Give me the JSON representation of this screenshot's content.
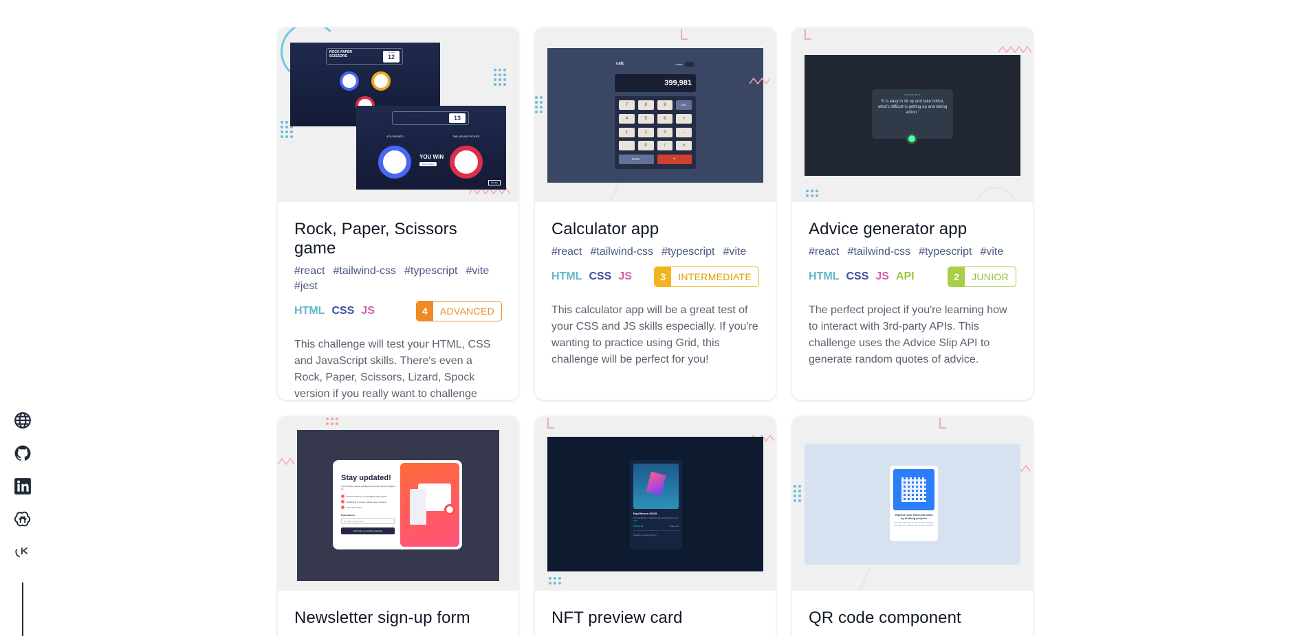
{
  "social": [
    {
      "name": "website-globe-icon",
      "label": "Website"
    },
    {
      "name": "github-icon",
      "label": "GitHub"
    },
    {
      "name": "linkedin-icon",
      "label": "LinkedIn"
    },
    {
      "name": "openai-icon",
      "label": "OpenAI"
    },
    {
      "name": "kodi-logo-icon",
      "label": "Logo"
    }
  ],
  "cards": [
    {
      "title": "Rock, Paper, Scissors game",
      "tags": [
        "#react",
        "#tailwind-css",
        "#typescript",
        "#vite",
        "#jest"
      ],
      "langs": [
        "HTML",
        "CSS",
        "JS"
      ],
      "level_num": "4",
      "level_label": "ADVANCED",
      "level_color": "#f08a24",
      "desc": "This challenge will test your HTML, CSS and JavaScript skills. There's even a Rock, Paper, Scissors, Lizard, Spock version if you really want to challenge yourself.",
      "preview": {
        "game_title": "ROCK PAPER SCISSORS",
        "score_label": "SCORE",
        "score_1": "12",
        "score_2": "13",
        "you_picked": "YOU PICKED",
        "house_picked": "THE HOUSE PICKED",
        "result": "YOU WIN",
        "play_again": "PLAY AGAIN",
        "rules": "RULES"
      }
    },
    {
      "title": "Calculator app",
      "tags": [
        "#react",
        "#tailwind-css",
        "#typescript",
        "#vite"
      ],
      "langs": [
        "HTML",
        "CSS",
        "JS"
      ],
      "level_num": "3",
      "level_label": "INTERMEDIATE",
      "level_color": "#f2b521",
      "desc": "This calculator app will be a great test of your CSS and JS skills especially. If you're wanting to practice using Grid, this challenge will be perfect for you!",
      "preview": {
        "brand": "calc",
        "theme": "THEME",
        "display": "399,981",
        "keys": [
          "7",
          "8",
          "9",
          "DEL",
          "4",
          "5",
          "6",
          "+",
          "1",
          "2",
          "3",
          "-",
          ".",
          "0",
          "/",
          "x"
        ],
        "reset": "RESET",
        "equals": "="
      }
    },
    {
      "title": "Advice generator app",
      "tags": [
        "#react",
        "#tailwind-css",
        "#typescript",
        "#vite"
      ],
      "langs": [
        "HTML",
        "CSS",
        "JS",
        "API"
      ],
      "level_num": "2",
      "level_label": "JUNIOR",
      "level_color": "#a8cf45",
      "desc": "The perfect project if you're learning how to interact with 3rd-party APIs. This challenge uses the Advice Slip API to generate random quotes of advice.",
      "preview": {
        "advice_label": "ADVICE #117",
        "quote": "“It is easy to sit up and take notice, what's difficult is getting up and taking action.”"
      }
    },
    {
      "title": "Newsletter sign-up form",
      "preview": {
        "heading": "Stay updated!",
        "sub": "Join 60,000+ product managers receiving monthly updates on:",
        "items": [
          "Product discovery and building what matters",
          "Measuring to ensure updates are a success",
          "And much more!"
        ],
        "email_label": "Email address",
        "email_placeholder": "email@company.com",
        "cta": "Subscribe to monthly newsletter"
      }
    },
    {
      "title": "NFT preview card",
      "preview": {
        "name": "Equilibrium #3429",
        "text": "Our Equilibrium collection promotes balance and calm.",
        "price": "0.041 ETH",
        "left": "3 days left",
        "creator": "Creation of Jules Wyvern"
      }
    },
    {
      "title": "QR code component",
      "preview": {
        "heading": "Improve your front-end skills by building projects",
        "text": "Scan the QR code to visit Frontend Mentor and take your coding skills to the next level"
      }
    }
  ]
}
